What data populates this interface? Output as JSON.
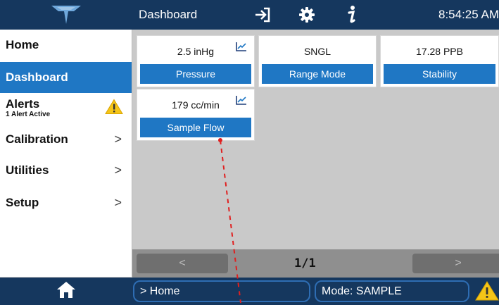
{
  "topbar": {
    "title": "Dashboard",
    "time": "8:54:25 AM",
    "icons": [
      "logo-icon",
      "login-icon",
      "gear-icon",
      "info-icon"
    ]
  },
  "sidebar": {
    "items": [
      {
        "label": "Home",
        "active": false
      },
      {
        "label": "Dashboard",
        "active": true
      },
      {
        "label": "Alerts",
        "sublabel": "1 Alert Active",
        "icon": "warning-icon"
      },
      {
        "label": "Calibration",
        "chevron": ">"
      },
      {
        "label": "Utilities",
        "chevron": ">"
      },
      {
        "label": "Setup",
        "chevron": ">"
      }
    ]
  },
  "tiles": [
    {
      "value": "2.5 inHg",
      "label": "Pressure",
      "icon": "chart-icon"
    },
    {
      "value": "SNGL",
      "label": "Range Mode"
    },
    {
      "value": "17.28 PPB",
      "label": "Stability"
    },
    {
      "value": "179 cc/min",
      "label": "Sample Flow",
      "icon": "chart-icon"
    }
  ],
  "pager": {
    "prev": "<",
    "page": "1/1",
    "next": ">"
  },
  "bottombar": {
    "breadcrumb": "> Home",
    "mode": "Mode: SAMPLE",
    "icons": [
      "home-icon",
      "warning-icon"
    ]
  },
  "colors": {
    "header_bg": "#15375e",
    "accent_blue": "#1f77c4",
    "warning_yellow": "#f5c518",
    "annotation_red": "#e02020"
  }
}
